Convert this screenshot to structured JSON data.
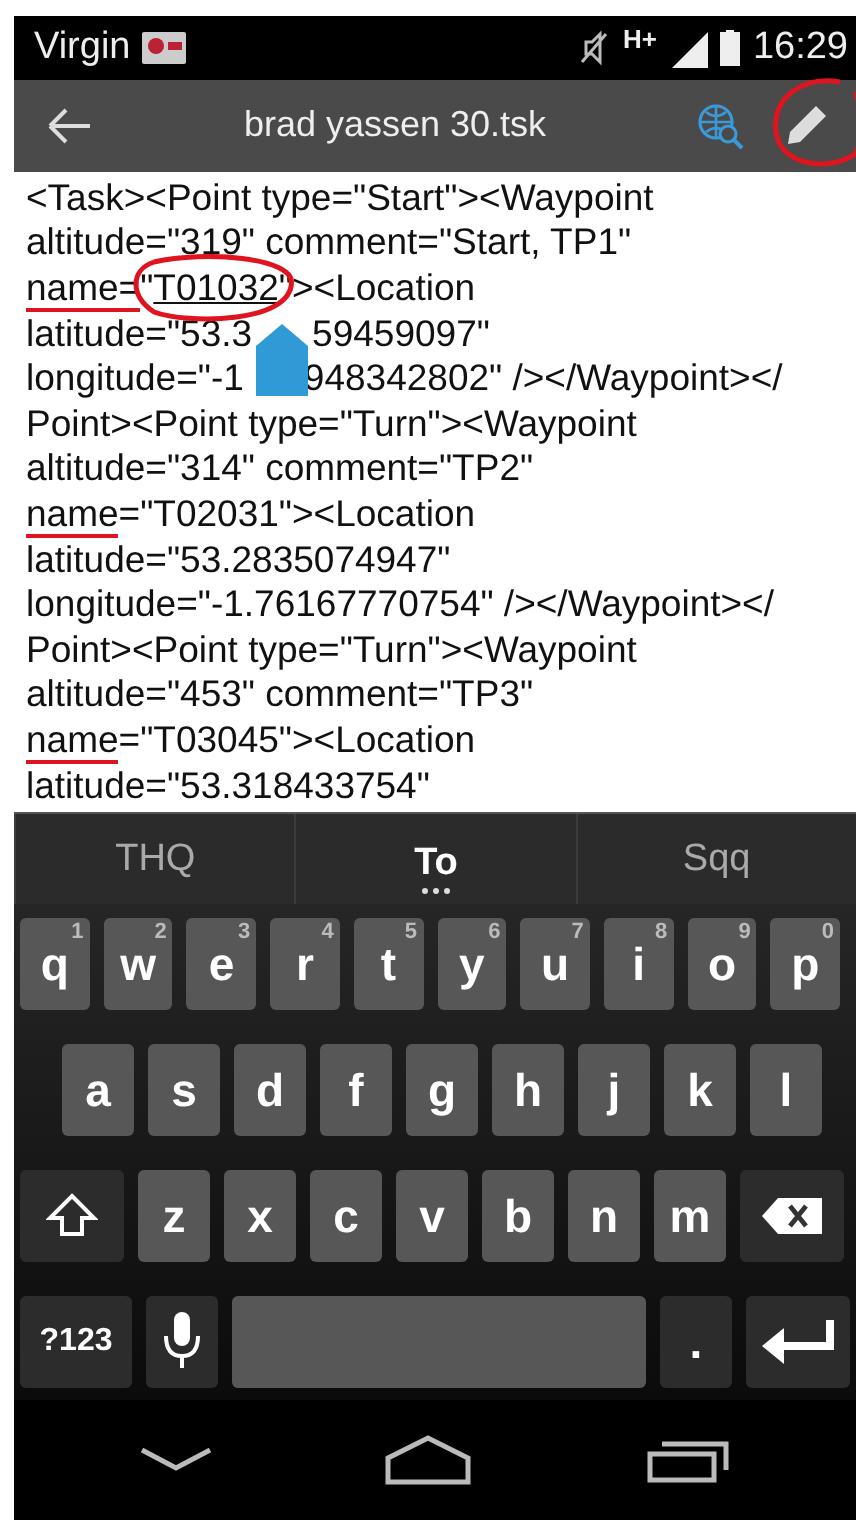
{
  "status_bar": {
    "carrier": "Virgin",
    "network": "H+",
    "time": "16:29"
  },
  "app_bar": {
    "title": "brad yassen 30.tsk",
    "edit_circled": true
  },
  "text": {
    "lines": [
      {
        "parts": [
          {
            "text": "<Task><Point type=\"Start\"><Waypoint"
          }
        ]
      },
      {
        "parts": [
          {
            "text": "altitude=\"319\" comment=\"Start, TP1\""
          }
        ]
      },
      {
        "parts": [
          {
            "text": "name=",
            "underlined": true
          },
          {
            "text": "\""
          },
          {
            "text": "T01032",
            "composing": true,
            "circled": true
          },
          {
            "text": "\"><Location"
          }
        ]
      },
      {
        "parts": [
          {
            "text": "latitude=\"53.3"
          },
          {
            "kind": "handle"
          },
          {
            "text": "59459097\""
          }
        ]
      },
      {
        "parts": [
          {
            "text": "longitude=\"-1"
          },
          {
            "kind": "covered"
          },
          {
            "text": "948342802\" /></Waypoint></"
          }
        ]
      },
      {
        "parts": [
          {
            "text": "Point><Point type=\"Turn\"><Waypoint"
          }
        ]
      },
      {
        "parts": [
          {
            "text": "altitude=\"314\" comment=\"TP2\""
          }
        ]
      },
      {
        "parts": [
          {
            "text": "name",
            "underlined": true
          },
          {
            "text": "=\"T02031\"><Location"
          }
        ]
      },
      {
        "parts": [
          {
            "text": "latitude=\"53.2835074947\""
          }
        ]
      },
      {
        "parts": [
          {
            "text": "longitude=\"-1.76167770754\" /></Waypoint></"
          }
        ]
      },
      {
        "parts": [
          {
            "text": "Point><Point type=\"Turn\"><Waypoint"
          }
        ]
      },
      {
        "parts": [
          {
            "text": "altitude=\"453\" comment=\"TP3\""
          }
        ]
      },
      {
        "parts": [
          {
            "text": "name",
            "underlined": true
          },
          {
            "text": "=\"T03045\"><Location"
          }
        ]
      },
      {
        "parts": [
          {
            "text": "latitude=\"53.318433754\""
          }
        ]
      }
    ]
  },
  "suggestions": [
    {
      "text": "THQ",
      "selected": false,
      "more": false
    },
    {
      "text": "To",
      "selected": true,
      "more": true
    },
    {
      "text": "Sqq",
      "selected": false,
      "more": false
    }
  ],
  "keyboard": {
    "rows": [
      {
        "keys": [
          {
            "kind": "letter",
            "label": "q",
            "hint": "1"
          },
          {
            "kind": "letter",
            "label": "w",
            "hint": "2"
          },
          {
            "kind": "letter",
            "label": "e",
            "hint": "3"
          },
          {
            "kind": "letter",
            "label": "r",
            "hint": "4"
          },
          {
            "kind": "letter",
            "label": "t",
            "hint": "5"
          },
          {
            "kind": "letter",
            "label": "y",
            "hint": "6"
          },
          {
            "kind": "letter",
            "label": "u",
            "hint": "7"
          },
          {
            "kind": "letter",
            "label": "i",
            "hint": "8"
          },
          {
            "kind": "letter",
            "label": "o",
            "hint": "9"
          },
          {
            "kind": "letter",
            "label": "p",
            "hint": "0"
          }
        ]
      },
      {
        "keys": [
          {
            "kind": "letter",
            "label": "a"
          },
          {
            "kind": "letter",
            "label": "s"
          },
          {
            "kind": "letter",
            "label": "d"
          },
          {
            "kind": "letter",
            "label": "f"
          },
          {
            "kind": "letter",
            "label": "g"
          },
          {
            "kind": "letter",
            "label": "h"
          },
          {
            "kind": "letter",
            "label": "j"
          },
          {
            "kind": "letter",
            "label": "k"
          },
          {
            "kind": "letter",
            "label": "l"
          }
        ]
      },
      {
        "keys": [
          {
            "kind": "shift"
          },
          {
            "kind": "letter",
            "label": "z"
          },
          {
            "kind": "letter",
            "label": "x"
          },
          {
            "kind": "letter",
            "label": "c"
          },
          {
            "kind": "letter",
            "label": "v"
          },
          {
            "kind": "letter",
            "label": "b"
          },
          {
            "kind": "letter",
            "label": "n"
          },
          {
            "kind": "letter",
            "label": "m"
          },
          {
            "kind": "backspace"
          }
        ]
      },
      {
        "keys": [
          {
            "kind": "symbols",
            "label": "?123"
          },
          {
            "kind": "mic"
          },
          {
            "kind": "space"
          },
          {
            "kind": "period",
            "label": "."
          },
          {
            "kind": "enter"
          }
        ]
      }
    ]
  }
}
